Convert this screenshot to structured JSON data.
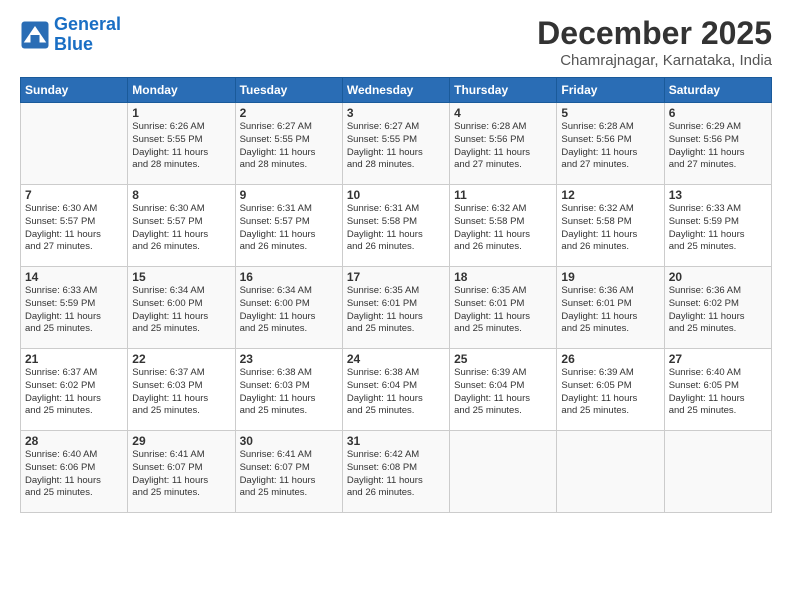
{
  "logo": {
    "line1": "General",
    "line2": "Blue"
  },
  "title": "December 2025",
  "subtitle": "Chamrajnagar, Karnataka, India",
  "days_of_week": [
    "Sunday",
    "Monday",
    "Tuesday",
    "Wednesday",
    "Thursday",
    "Friday",
    "Saturday"
  ],
  "weeks": [
    [
      {
        "day": "",
        "info": ""
      },
      {
        "day": "1",
        "info": "Sunrise: 6:26 AM\nSunset: 5:55 PM\nDaylight: 11 hours\nand 28 minutes."
      },
      {
        "day": "2",
        "info": "Sunrise: 6:27 AM\nSunset: 5:55 PM\nDaylight: 11 hours\nand 28 minutes."
      },
      {
        "day": "3",
        "info": "Sunrise: 6:27 AM\nSunset: 5:55 PM\nDaylight: 11 hours\nand 28 minutes."
      },
      {
        "day": "4",
        "info": "Sunrise: 6:28 AM\nSunset: 5:56 PM\nDaylight: 11 hours\nand 27 minutes."
      },
      {
        "day": "5",
        "info": "Sunrise: 6:28 AM\nSunset: 5:56 PM\nDaylight: 11 hours\nand 27 minutes."
      },
      {
        "day": "6",
        "info": "Sunrise: 6:29 AM\nSunset: 5:56 PM\nDaylight: 11 hours\nand 27 minutes."
      }
    ],
    [
      {
        "day": "7",
        "info": "Sunrise: 6:30 AM\nSunset: 5:57 PM\nDaylight: 11 hours\nand 27 minutes."
      },
      {
        "day": "8",
        "info": "Sunrise: 6:30 AM\nSunset: 5:57 PM\nDaylight: 11 hours\nand 26 minutes."
      },
      {
        "day": "9",
        "info": "Sunrise: 6:31 AM\nSunset: 5:57 PM\nDaylight: 11 hours\nand 26 minutes."
      },
      {
        "day": "10",
        "info": "Sunrise: 6:31 AM\nSunset: 5:58 PM\nDaylight: 11 hours\nand 26 minutes."
      },
      {
        "day": "11",
        "info": "Sunrise: 6:32 AM\nSunset: 5:58 PM\nDaylight: 11 hours\nand 26 minutes."
      },
      {
        "day": "12",
        "info": "Sunrise: 6:32 AM\nSunset: 5:58 PM\nDaylight: 11 hours\nand 26 minutes."
      },
      {
        "day": "13",
        "info": "Sunrise: 6:33 AM\nSunset: 5:59 PM\nDaylight: 11 hours\nand 25 minutes."
      }
    ],
    [
      {
        "day": "14",
        "info": "Sunrise: 6:33 AM\nSunset: 5:59 PM\nDaylight: 11 hours\nand 25 minutes."
      },
      {
        "day": "15",
        "info": "Sunrise: 6:34 AM\nSunset: 6:00 PM\nDaylight: 11 hours\nand 25 minutes."
      },
      {
        "day": "16",
        "info": "Sunrise: 6:34 AM\nSunset: 6:00 PM\nDaylight: 11 hours\nand 25 minutes."
      },
      {
        "day": "17",
        "info": "Sunrise: 6:35 AM\nSunset: 6:01 PM\nDaylight: 11 hours\nand 25 minutes."
      },
      {
        "day": "18",
        "info": "Sunrise: 6:35 AM\nSunset: 6:01 PM\nDaylight: 11 hours\nand 25 minutes."
      },
      {
        "day": "19",
        "info": "Sunrise: 6:36 AM\nSunset: 6:01 PM\nDaylight: 11 hours\nand 25 minutes."
      },
      {
        "day": "20",
        "info": "Sunrise: 6:36 AM\nSunset: 6:02 PM\nDaylight: 11 hours\nand 25 minutes."
      }
    ],
    [
      {
        "day": "21",
        "info": "Sunrise: 6:37 AM\nSunset: 6:02 PM\nDaylight: 11 hours\nand 25 minutes."
      },
      {
        "day": "22",
        "info": "Sunrise: 6:37 AM\nSunset: 6:03 PM\nDaylight: 11 hours\nand 25 minutes."
      },
      {
        "day": "23",
        "info": "Sunrise: 6:38 AM\nSunset: 6:03 PM\nDaylight: 11 hours\nand 25 minutes."
      },
      {
        "day": "24",
        "info": "Sunrise: 6:38 AM\nSunset: 6:04 PM\nDaylight: 11 hours\nand 25 minutes."
      },
      {
        "day": "25",
        "info": "Sunrise: 6:39 AM\nSunset: 6:04 PM\nDaylight: 11 hours\nand 25 minutes."
      },
      {
        "day": "26",
        "info": "Sunrise: 6:39 AM\nSunset: 6:05 PM\nDaylight: 11 hours\nand 25 minutes."
      },
      {
        "day": "27",
        "info": "Sunrise: 6:40 AM\nSunset: 6:05 PM\nDaylight: 11 hours\nand 25 minutes."
      }
    ],
    [
      {
        "day": "28",
        "info": "Sunrise: 6:40 AM\nSunset: 6:06 PM\nDaylight: 11 hours\nand 25 minutes."
      },
      {
        "day": "29",
        "info": "Sunrise: 6:41 AM\nSunset: 6:07 PM\nDaylight: 11 hours\nand 25 minutes."
      },
      {
        "day": "30",
        "info": "Sunrise: 6:41 AM\nSunset: 6:07 PM\nDaylight: 11 hours\nand 25 minutes."
      },
      {
        "day": "31",
        "info": "Sunrise: 6:42 AM\nSunset: 6:08 PM\nDaylight: 11 hours\nand 26 minutes."
      },
      {
        "day": "",
        "info": ""
      },
      {
        "day": "",
        "info": ""
      },
      {
        "day": "",
        "info": ""
      }
    ]
  ]
}
